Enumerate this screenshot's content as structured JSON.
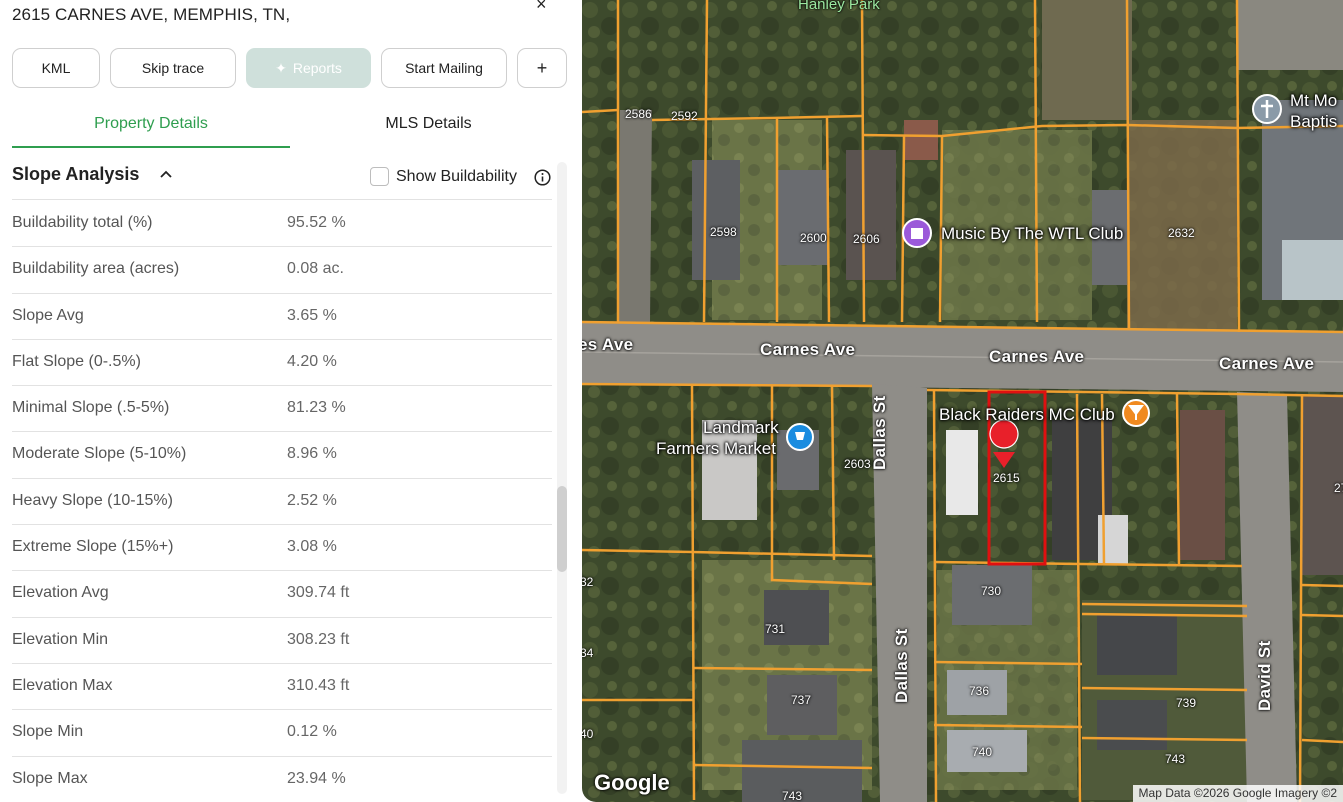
{
  "header": {
    "address": "2615 CARNES AVE, MEMPHIS, TN,",
    "close": "×"
  },
  "toolbar": {
    "kml": "KML",
    "skip_trace": "Skip trace",
    "reports": "Reports",
    "start_mailing": "Start Mailing",
    "plus": "+"
  },
  "tabs": {
    "property_details": "Property Details",
    "mls_details": "MLS Details"
  },
  "slope": {
    "title": "Slope Analysis",
    "show_buildability": "Show Buildability",
    "rows": [
      {
        "label": "Buildability total (%)",
        "value": "95.52 %"
      },
      {
        "label": "Buildability area (acres)",
        "value": "0.08 ac."
      },
      {
        "label": "Slope Avg",
        "value": "3.65 %"
      },
      {
        "label": "Flat Slope (0-.5%)",
        "value": "4.20 %"
      },
      {
        "label": "Minimal Slope (.5-5%)",
        "value": "81.23 %"
      },
      {
        "label": "Moderate Slope (5-10%)",
        "value": "8.96 %"
      },
      {
        "label": "Heavy Slope (10-15%)",
        "value": "2.52 %"
      },
      {
        "label": "Extreme Slope (15%+)",
        "value": "3.08 %"
      },
      {
        "label": "Elevation Avg",
        "value": "309.74 ft"
      },
      {
        "label": "Elevation Min",
        "value": "308.23 ft"
      },
      {
        "label": "Elevation Max",
        "value": "310.43 ft"
      },
      {
        "label": "Slope Min",
        "value": "0.12 %"
      },
      {
        "label": "Slope Max",
        "value": "23.94 %"
      }
    ]
  },
  "map": {
    "park": "Hanley Park",
    "streets": {
      "carnes_left": "es Ave",
      "carnes_1": "Carnes Ave",
      "carnes_2": "Carnes Ave",
      "carnes_3": "Carnes Ave",
      "dallas_top": "Dallas St",
      "dallas_bottom": "Dallas St",
      "david": "David St"
    },
    "pois": {
      "music": "Music By The WTL Club",
      "black_raiders": "Black Raiders MC Club",
      "landmark_1": "Landmark",
      "landmark_2": "Farmers Market",
      "church_1": "Mt Mo",
      "church_2": "Baptis"
    },
    "parcel_numbers": {
      "n2586": "2586",
      "n2592": "2592",
      "n2598": "2598",
      "n2600": "2600",
      "n2606": "2606",
      "n2632": "2632",
      "n2603": "2603",
      "n2615": "2615",
      "n730": "730",
      "n731": "731",
      "n736": "736",
      "n737": "737",
      "n739": "739",
      "n740": "740",
      "n743a": "743",
      "n743b": "743",
      "n32": "32",
      "n34": "34",
      "n40": "40",
      "n27": "27"
    },
    "google": "Google",
    "attribution": "Map Data ©2026 Google Imagery ©2"
  },
  "colors": {
    "accent": "#2f9e4f",
    "parcel_line": "#f0a030",
    "selected_parcel": "#e01010",
    "pin": "#e8202a"
  }
}
